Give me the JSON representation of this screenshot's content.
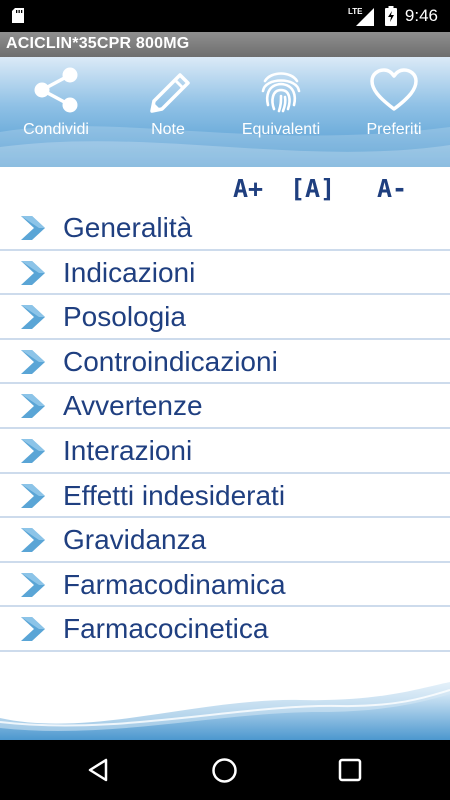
{
  "status_bar": {
    "network": "LTE",
    "time": "9:46",
    "icons": [
      "sd-card-icon",
      "lte-signal-icon",
      "battery-icon"
    ]
  },
  "title_bar": {
    "title": "ACICLIN*35CPR 800MG"
  },
  "toolbar": {
    "buttons": [
      {
        "label": "Condividi",
        "icon": "share-icon"
      },
      {
        "label": "Note",
        "icon": "pencil-icon"
      },
      {
        "label": "Equivalenti",
        "icon": "fingerprint-icon"
      },
      {
        "label": "Preferiti",
        "icon": "heart-icon"
      }
    ]
  },
  "font_controls": {
    "increase": "A+",
    "reset": "[A]",
    "decrease": "A-"
  },
  "menu": {
    "items": [
      {
        "label": "Generalità"
      },
      {
        "label": "Indicazioni"
      },
      {
        "label": "Posologia"
      },
      {
        "label": "Controindicazioni"
      },
      {
        "label": "Avvertenze"
      },
      {
        "label": "Interazioni"
      },
      {
        "label": "Effetti indesiderati"
      },
      {
        "label": "Gravidanza"
      },
      {
        "label": "Farmacodinamica"
      },
      {
        "label": "Farmacocinetica"
      }
    ]
  },
  "nav_bar": {
    "icons": [
      "back-icon",
      "home-icon",
      "recents-icon"
    ]
  },
  "colors": {
    "accent": "#1f3f80",
    "toolbar_gradient_top": "#dbeaf7",
    "toolbar_gradient_bottom": "#4d99d0",
    "chevron": "#5aa5d6",
    "divider": "#cddbec"
  }
}
